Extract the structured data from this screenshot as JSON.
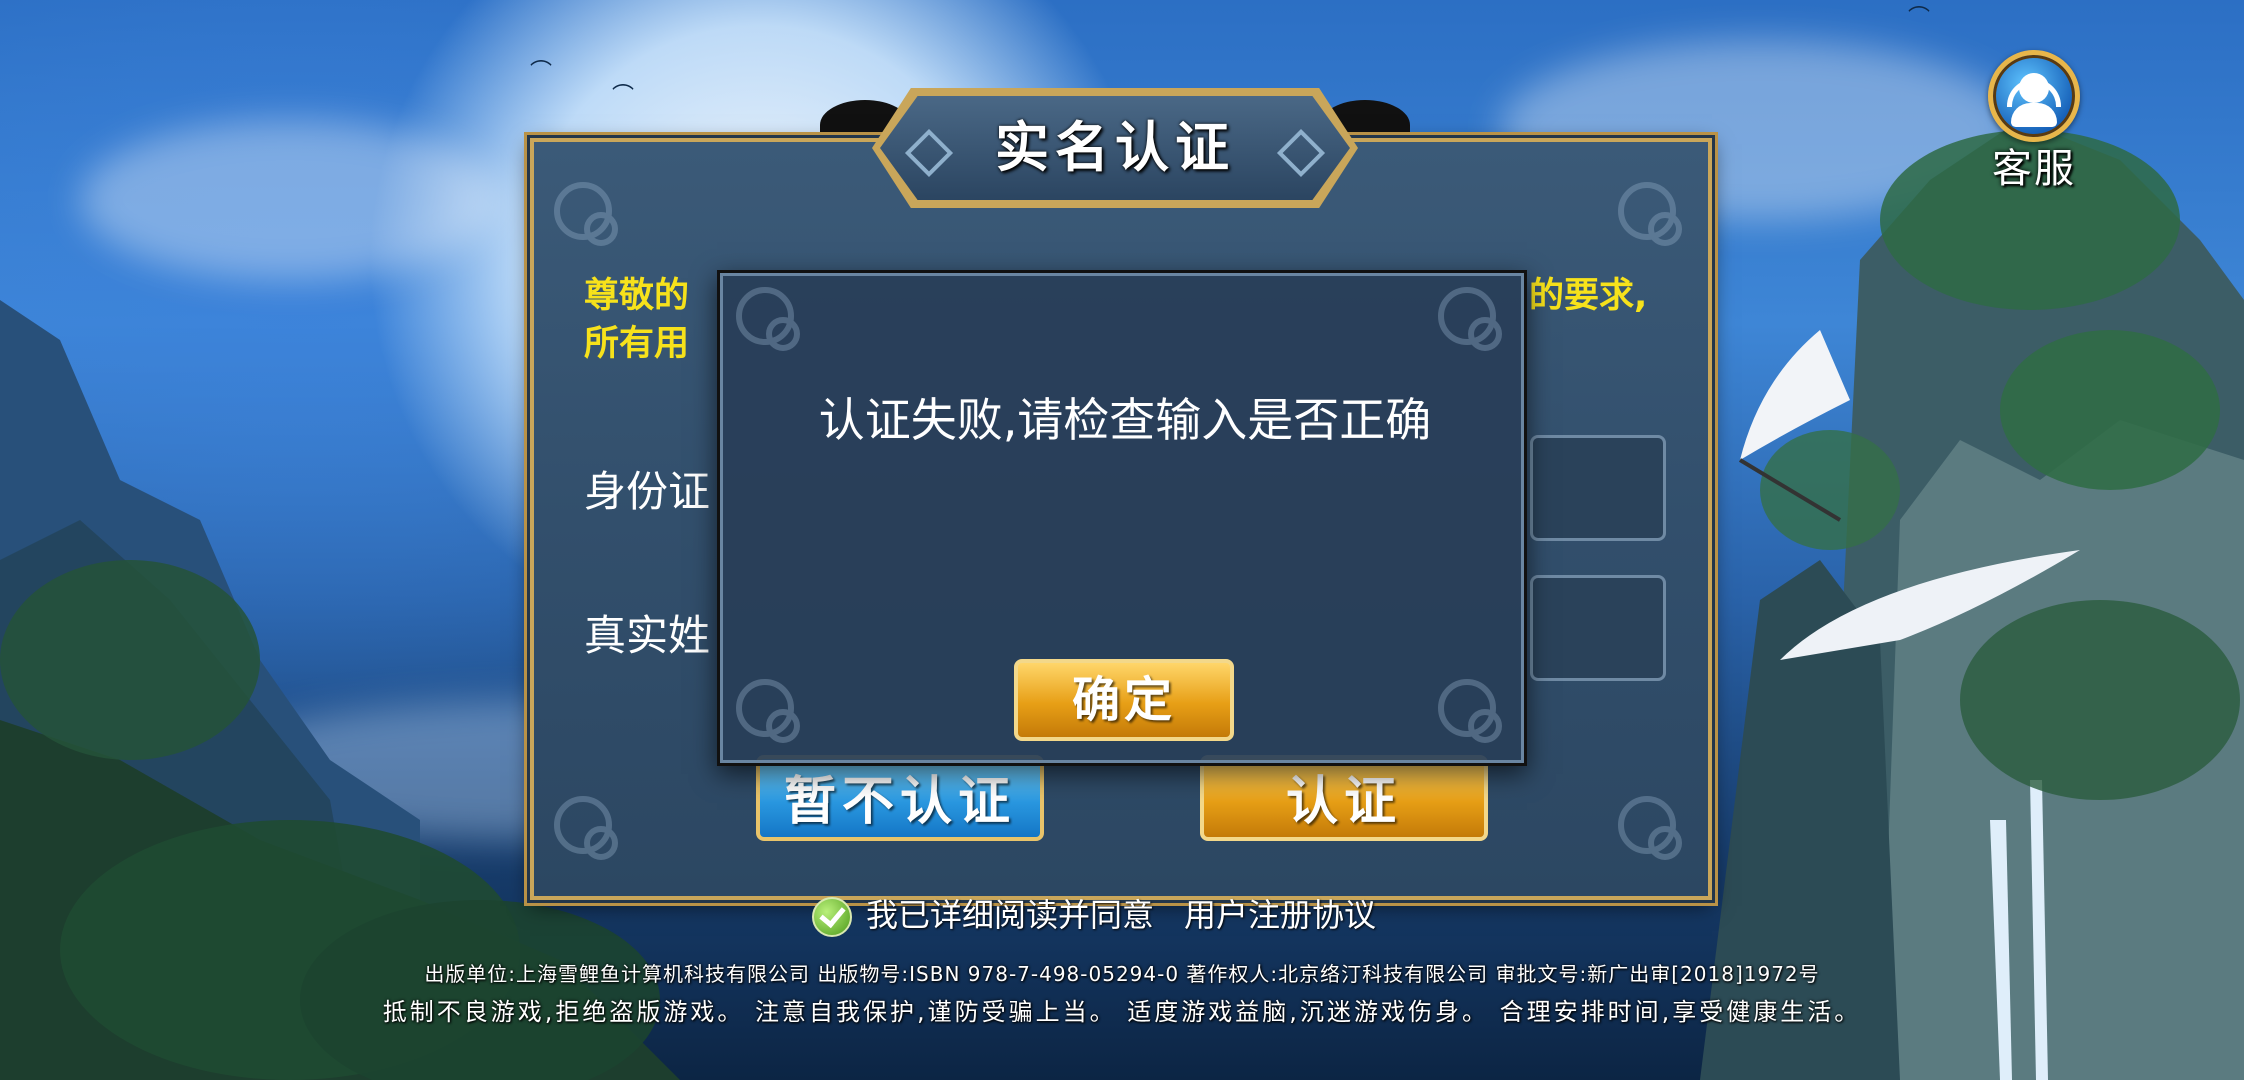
{
  "customer_service": {
    "label": "客服",
    "icon": "headset-icon"
  },
  "dialog": {
    "title": "实名认证",
    "notice_line1": "尊敬的",
    "notice_line1_end": "的要求,",
    "notice_line2": "所有用",
    "id_label": "身份证",
    "name_label": "真实姓",
    "skip_button": "暂不认证",
    "auth_button": "认证"
  },
  "agreement": {
    "text": "我已详细阅读并同意",
    "link": "用户注册协议"
  },
  "footer": {
    "line1": "出版单位:上海雪鲤鱼计算机科技有限公司  出版物号:ISBN 978-7-498-05294-0   著作权人:北京络汀科技有限公司   审批文号:新广出审[2018]1972号",
    "line2": "抵制不良游戏,拒绝盗版游戏。 注意自我保护,谨防受骗上当。 适度游戏益脑,沉迷游戏伤身。 合理安排时间,享受健康生活。"
  },
  "alert": {
    "message": "认证失败,请检查输入是否正确",
    "ok_button": "确定"
  }
}
